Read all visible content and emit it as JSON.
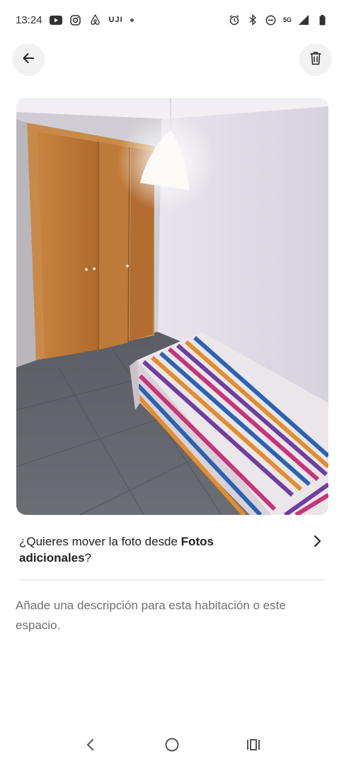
{
  "status_bar": {
    "time": "13:24",
    "carrier_label": "UJI",
    "network": "5G",
    "left_icons": [
      "youtube-icon",
      "instagram-icon",
      "airbnb-icon",
      "uji-app-icon",
      "notification-dot"
    ],
    "right_icons": [
      "alarm-icon",
      "bluetooth-icon",
      "do-not-disturb-icon",
      "network-5g-icon",
      "signal-icon",
      "battery-icon"
    ]
  },
  "header": {
    "back_icon": "arrow-left-icon",
    "delete_icon": "trash-icon"
  },
  "photo": {
    "subject": "bedroom-photo"
  },
  "move_prompt": {
    "text_before": "¿Quieres mover la foto desde ",
    "bold_text": "Fotos adicionales",
    "text_after": "?",
    "icon": "chevron-right-icon"
  },
  "description": {
    "placeholder": "Añade una descripción para esta habitación o este espacio."
  },
  "nav_bar": {
    "items": [
      "back-nav-icon",
      "home-nav-icon",
      "recents-nav-icon"
    ]
  }
}
